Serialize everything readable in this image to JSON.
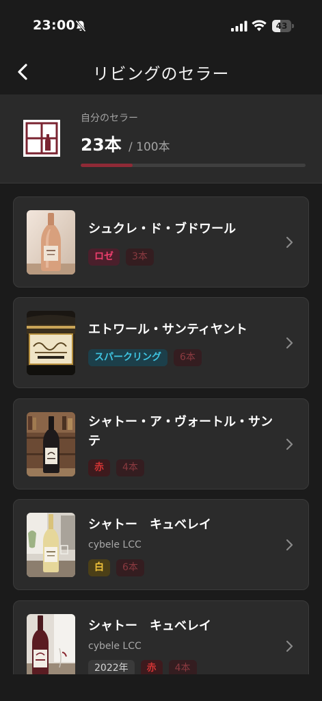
{
  "status_bar": {
    "time": "23:00",
    "battery_level": "43",
    "battery_fraction": 0.43
  },
  "nav": {
    "title": "リビングのセラー",
    "back_icon": "chevron-left-icon"
  },
  "summary": {
    "label": "自分のセラー",
    "count": "23本",
    "total": "/ 100本",
    "progress_fraction": 0.23,
    "icon": "wine-cellar-icon"
  },
  "colors": {
    "background": "#1b1b1b",
    "card": "#2b2b2b",
    "accent": "#8f2a36",
    "rose": "#ef3f6e",
    "sparkling": "#3fc5e2",
    "red": "#d03434",
    "white": "#f1c33b"
  },
  "wines": [
    {
      "name": "シュクレ・ド・ブドワール",
      "type": "ロゼ",
      "count": "3本"
    },
    {
      "name": "エトワール・サンティヤント",
      "type": "スパークリング",
      "count": "6本"
    },
    {
      "name": "シャトー・ア・ヴォートル・サンテ",
      "type": "赤",
      "count": "4本"
    },
    {
      "name": "シャトー　キュベレイ",
      "producer": "cybele LCC",
      "type": "白",
      "count": "6本"
    },
    {
      "name": "シャトー　キュベレイ",
      "producer": "cybele LCC",
      "year": "2022年",
      "type": "赤",
      "count": "4本"
    }
  ]
}
